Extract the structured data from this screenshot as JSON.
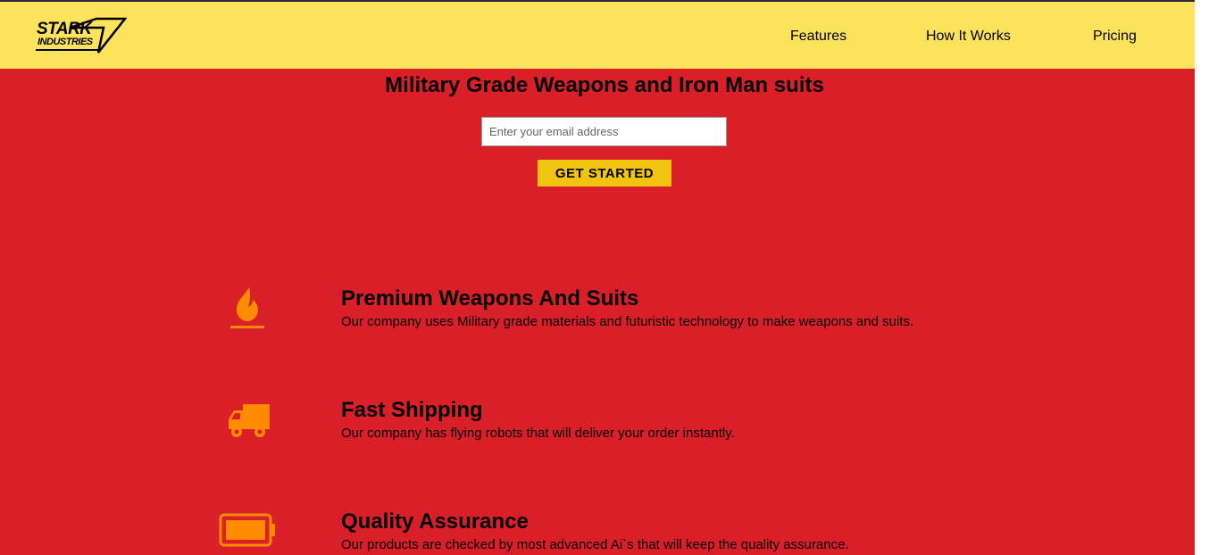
{
  "brand": {
    "logo_line1": "STARK",
    "logo_line2": "INDUSTRIES"
  },
  "nav": {
    "items": [
      {
        "label": "Features"
      },
      {
        "label": "How It Works"
      },
      {
        "label": "Pricing"
      }
    ]
  },
  "hero": {
    "title": "Military Grade Weapons and Iron Man suits",
    "email_placeholder": "Enter your email address",
    "email_value": "",
    "cta_label": "GET STARTED"
  },
  "features": [
    {
      "icon": "fire-icon",
      "title": "Premium Weapons And Suits",
      "description": "Our company uses Military grade materials and futuristic technology to make weapons and suits."
    },
    {
      "icon": "truck-icon",
      "title": "Fast Shipping",
      "description": "Our company has flying robots that will deliver your order instantly."
    },
    {
      "icon": "battery-icon",
      "title": "Quality Assurance",
      "description": "Our products are checked by most advanced Ai`s that will keep the quality assurance."
    }
  ],
  "colors": {
    "page_background": "#d91f27",
    "header_background": "#fde35b",
    "button_background": "#f1c40f",
    "icon_color": "#ff8c00"
  }
}
